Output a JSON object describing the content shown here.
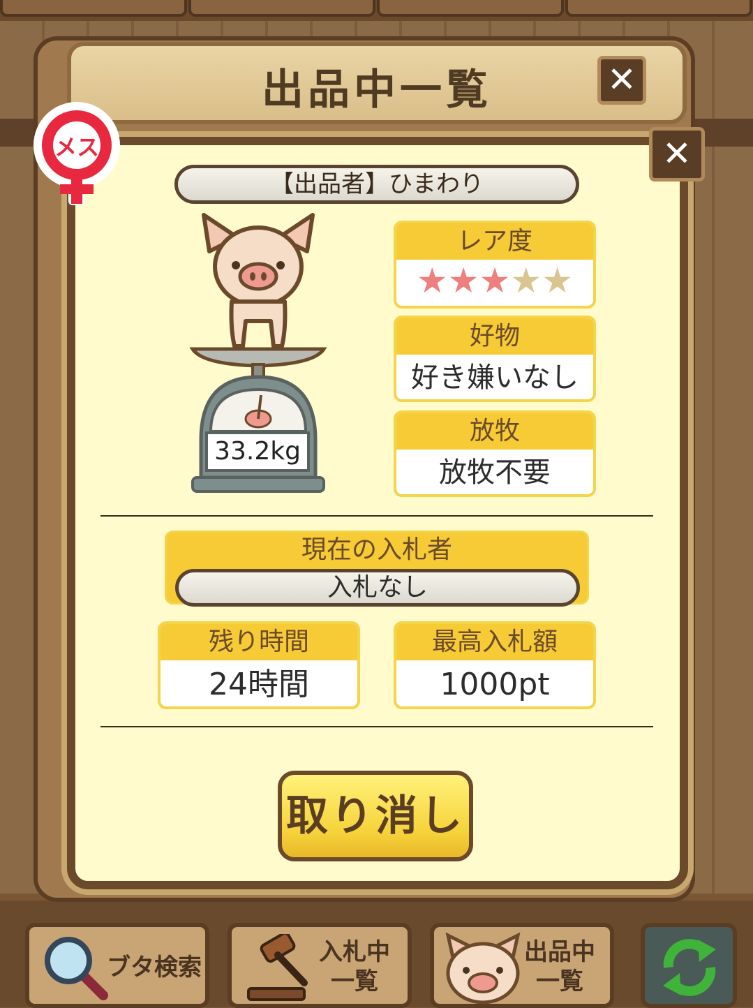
{
  "window_title": "出品中一覧",
  "detail": {
    "seller": "【出品者】ひまわり",
    "gender_badge": "メス",
    "weight": "33.2kg",
    "rarity": {
      "label": "レア度",
      "filled": 3,
      "total": 5
    },
    "favorite": {
      "label": "好物",
      "value": "好き嫌いなし"
    },
    "grazing": {
      "label": "放牧",
      "value": "放牧不要"
    },
    "bidder": {
      "label": "現在の入札者",
      "value": "入札なし"
    },
    "time_left": {
      "label": "残り時間",
      "value": "24時間"
    },
    "top_bid": {
      "label": "最高入札額",
      "value": "1000pt"
    },
    "cancel_label": "取り消し"
  },
  "nav": {
    "search_label": "ブタ検索",
    "bidding_label_1": "入札中",
    "bidding_label_2": "一覧",
    "listing_label_1": "出品中",
    "listing_label_2": "一覧"
  },
  "colors": {
    "accent": "#f6cb35",
    "panel": "#fffbcd",
    "wood": "#6b4a2c",
    "star_on": "#ef7f7f",
    "star_off": "#d8c58f"
  },
  "icons": [
    "close-icon",
    "female-icon",
    "pig-on-scale-icon",
    "magnifier-icon",
    "gavel-icon",
    "pig-face-icon",
    "refresh-icon"
  ]
}
